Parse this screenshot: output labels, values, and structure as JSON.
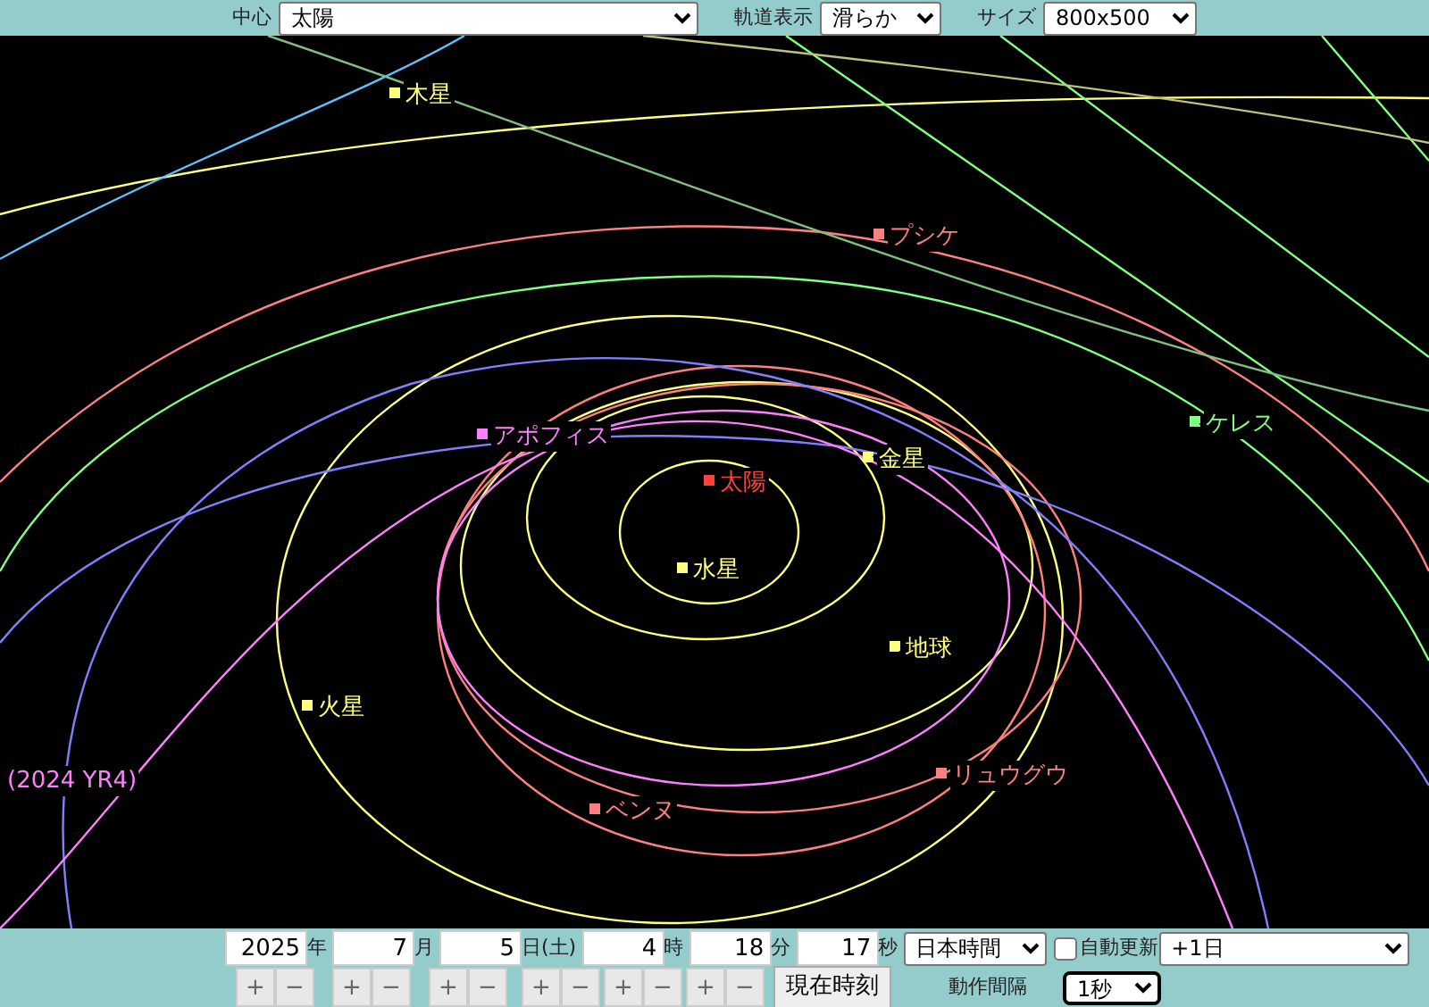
{
  "toolbar": {
    "center_label": "中心",
    "center_value": "太陽",
    "orbit_label": "軌道表示",
    "orbit_value": "滑らか",
    "size_label": "サイズ",
    "size_value": "800x500"
  },
  "bodies": [
    {
      "name": "木星",
      "color": "#ffff80",
      "kind": "marked"
    },
    {
      "name": "プシケ",
      "color": "#ff8080",
      "kind": "marked"
    },
    {
      "name": "ケレス",
      "color": "#80ff80",
      "kind": "marked"
    },
    {
      "name": "アポフィス",
      "color": "#ff80ff",
      "kind": "marked"
    },
    {
      "name": "金星",
      "color": "#ffff80",
      "kind": "marked"
    },
    {
      "name": "太陽",
      "color": "#ff4040",
      "kind": "marked"
    },
    {
      "name": "水星",
      "color": "#ffff80",
      "kind": "marked"
    },
    {
      "name": "地球",
      "color": "#ffff80",
      "kind": "marked"
    },
    {
      "name": "火星",
      "color": "#ffff80",
      "kind": "marked"
    },
    {
      "name": "リュウグウ",
      "color": "#ff8080",
      "kind": "marked"
    },
    {
      "name": "ベンヌ",
      "color": "#ff8080",
      "kind": "marked"
    },
    {
      "name": "(2024 YR4)",
      "color": "#ff80ff",
      "kind": "label"
    }
  ],
  "date_fields": [
    {
      "value": "2025",
      "unit": "年"
    },
    {
      "value": "7",
      "unit": "月"
    },
    {
      "value": "5",
      "unit": "日(土)"
    },
    {
      "value": "4",
      "unit": "時"
    },
    {
      "value": "18",
      "unit": "分"
    },
    {
      "value": "17",
      "unit": "秒"
    }
  ],
  "timezone": "日本時間",
  "auto_update": {
    "label": "自動更新",
    "checked": false
  },
  "step": "+1日",
  "steppers": [
    {
      "plus": "+",
      "minus": "−"
    },
    {
      "plus": "+",
      "minus": "−"
    },
    {
      "plus": "+",
      "minus": "−"
    },
    {
      "plus": "+",
      "minus": "−"
    },
    {
      "plus": "+",
      "minus": "−"
    },
    {
      "plus": "+",
      "minus": "−"
    }
  ],
  "now_button": "現在時刻",
  "interval_label": "動作間隔",
  "interval_value": "1秒"
}
